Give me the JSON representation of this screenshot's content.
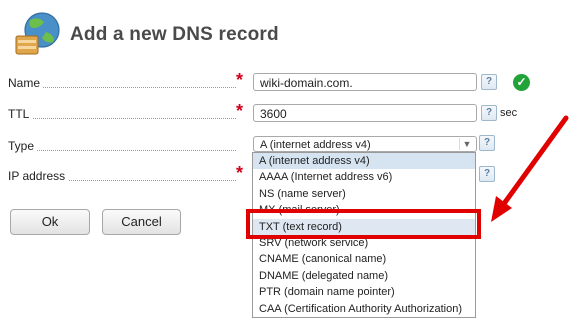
{
  "header": {
    "title": "Add a new DNS record",
    "logo_icon": "globe-server-icon"
  },
  "form": {
    "name": {
      "label": "Name",
      "value": "wiki-domain.com.",
      "help": "?"
    },
    "ttl": {
      "label": "TTL",
      "value": "3600",
      "unit": "sec",
      "help": "?"
    },
    "type": {
      "label": "Type",
      "selected": "A (internet address v4)",
      "help": "?",
      "options": [
        "A (internet address v4)",
        "AAAA (Internet address v6)",
        "NS (name server)",
        "MX (mail server)",
        "TXT (text record)",
        "SRV (network service)",
        "CNAME (canonical name)",
        "DNAME (delegated name)",
        "PTR (domain name pointer)",
        "CAA (Certification Authority Authorization)"
      ]
    },
    "ip": {
      "label": "IP address",
      "help": "?"
    }
  },
  "buttons": {
    "ok": "Ok",
    "cancel": "Cancel"
  },
  "required_mark": "*",
  "colors": {
    "annotation_red": "#e00000",
    "valid_green": "#22a33a",
    "required_red": "#d0021b"
  }
}
